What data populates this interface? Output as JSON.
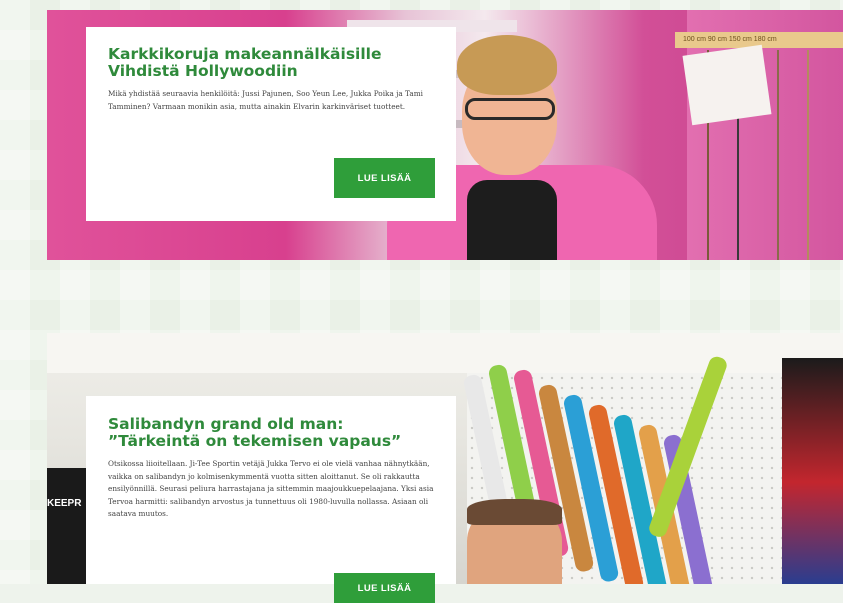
{
  "articles": [
    {
      "title": "Karkkikoruja makeannälkäisille Vihdistä Hollywoodiin",
      "excerpt": "Mikä yhdistää seuraavia henkilöitä: Jussi Pajunen, Soo Yeun Lee, Jukka Poika ja Tami Tamminen? Varmaan monikin asia, mutta ainakin Elvarin karkinväriset tuotteet.",
      "cta_label": "LUE LISÄÄ",
      "sign_text": "100 cm  90 cm  150 cm  180 cm"
    },
    {
      "title": "Salibandyn grand old man: ”Tärkeintä on tekemisen vapaus”",
      "excerpt": "Otsikossa liioitellaan. Ji-Tee Sportin vetäjä Jukka Tervo ei ole vielä vanhaa nähnytkään, vaikka on salibandyn jo kolmisenkymmentä vuotta sitten aloittanut. Se oli rakkautta ensilyönnillä. Seurasi peliura harrastajana ja sittemmin maajoukkuepelaajana. Yksi asia Tervoa harmitti: salibandyn arvostus ja tunnettuus oli 1980-luvulla nollassa. Asiaan oli saatava muutos.",
      "cta_label": "LUE LISÄÄ",
      "shirt_text": "KEEPR"
    }
  ],
  "colors": {
    "accent_green": "#2f9e3a",
    "title_green": "#2f8a3b",
    "card_bg": "#ffffff"
  }
}
